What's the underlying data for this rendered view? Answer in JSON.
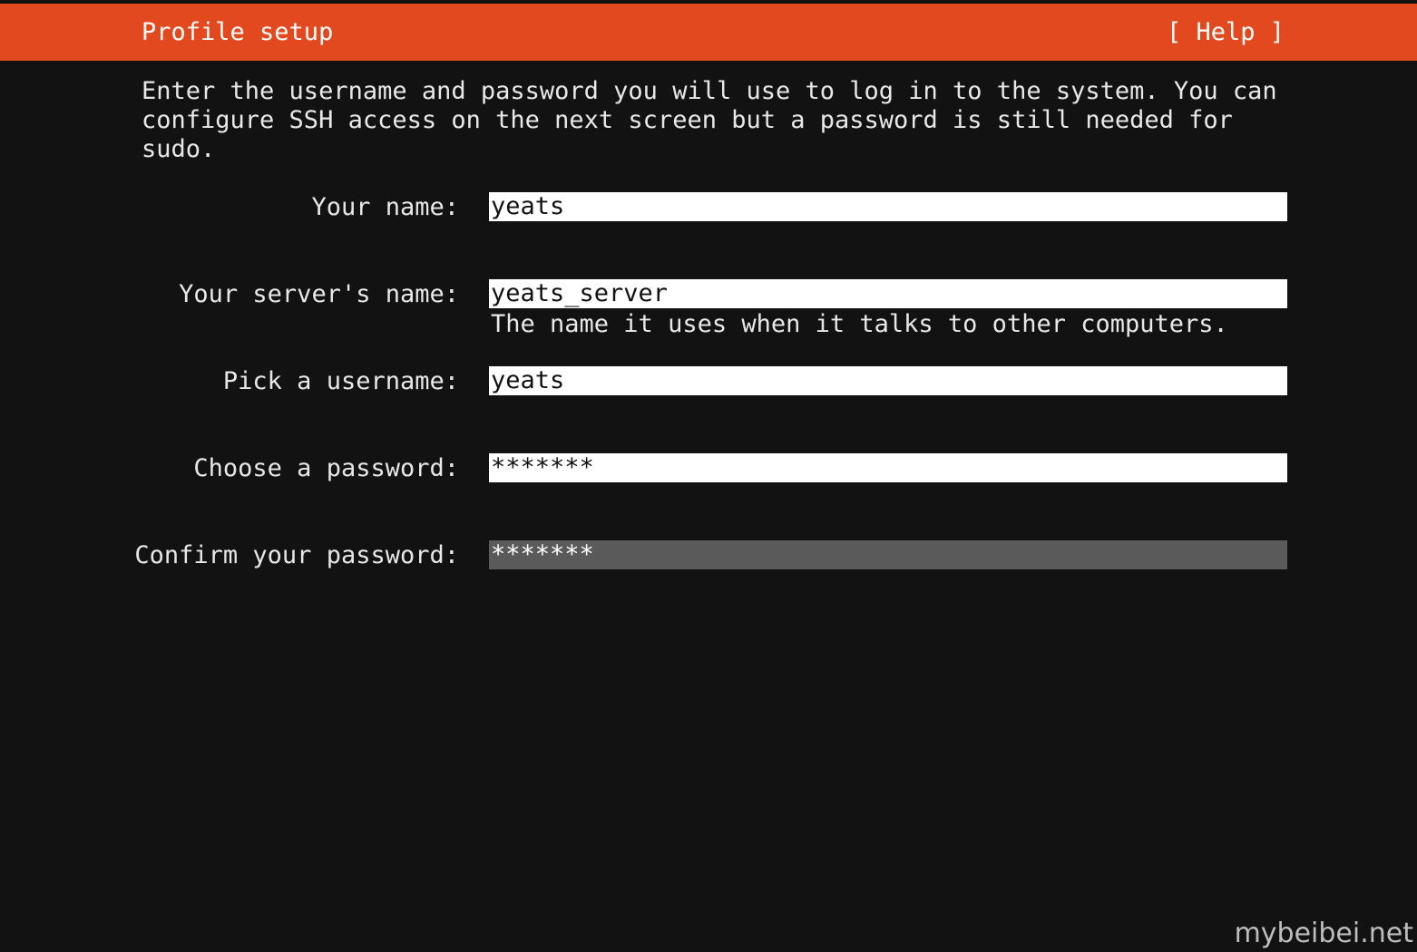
{
  "header": {
    "title": "Profile setup",
    "help_label": "[ Help ]"
  },
  "intro_text": "Enter the username and password you will use to log in to the system. You can\nconfigure SSH access on the next screen but a password is still needed for\nsudo.",
  "form": {
    "your_name": {
      "label": "Your name:",
      "value": "yeats"
    },
    "server_name": {
      "label": "Your server's name:",
      "value": "yeats_server",
      "hint": "The name it uses when it talks to other computers."
    },
    "username": {
      "label": "Pick a username:",
      "value": "yeats"
    },
    "password": {
      "label": "Choose a password:",
      "value": "*******"
    },
    "confirm_password": {
      "label": "Confirm your password:",
      "value": "*******"
    }
  },
  "watermark": "mybeibei.net",
  "colors": {
    "header_bg": "#e3491f",
    "screen_bg": "#121212",
    "field_bg": "#ffffff",
    "focused_field_bg": "#5a5a5a"
  }
}
